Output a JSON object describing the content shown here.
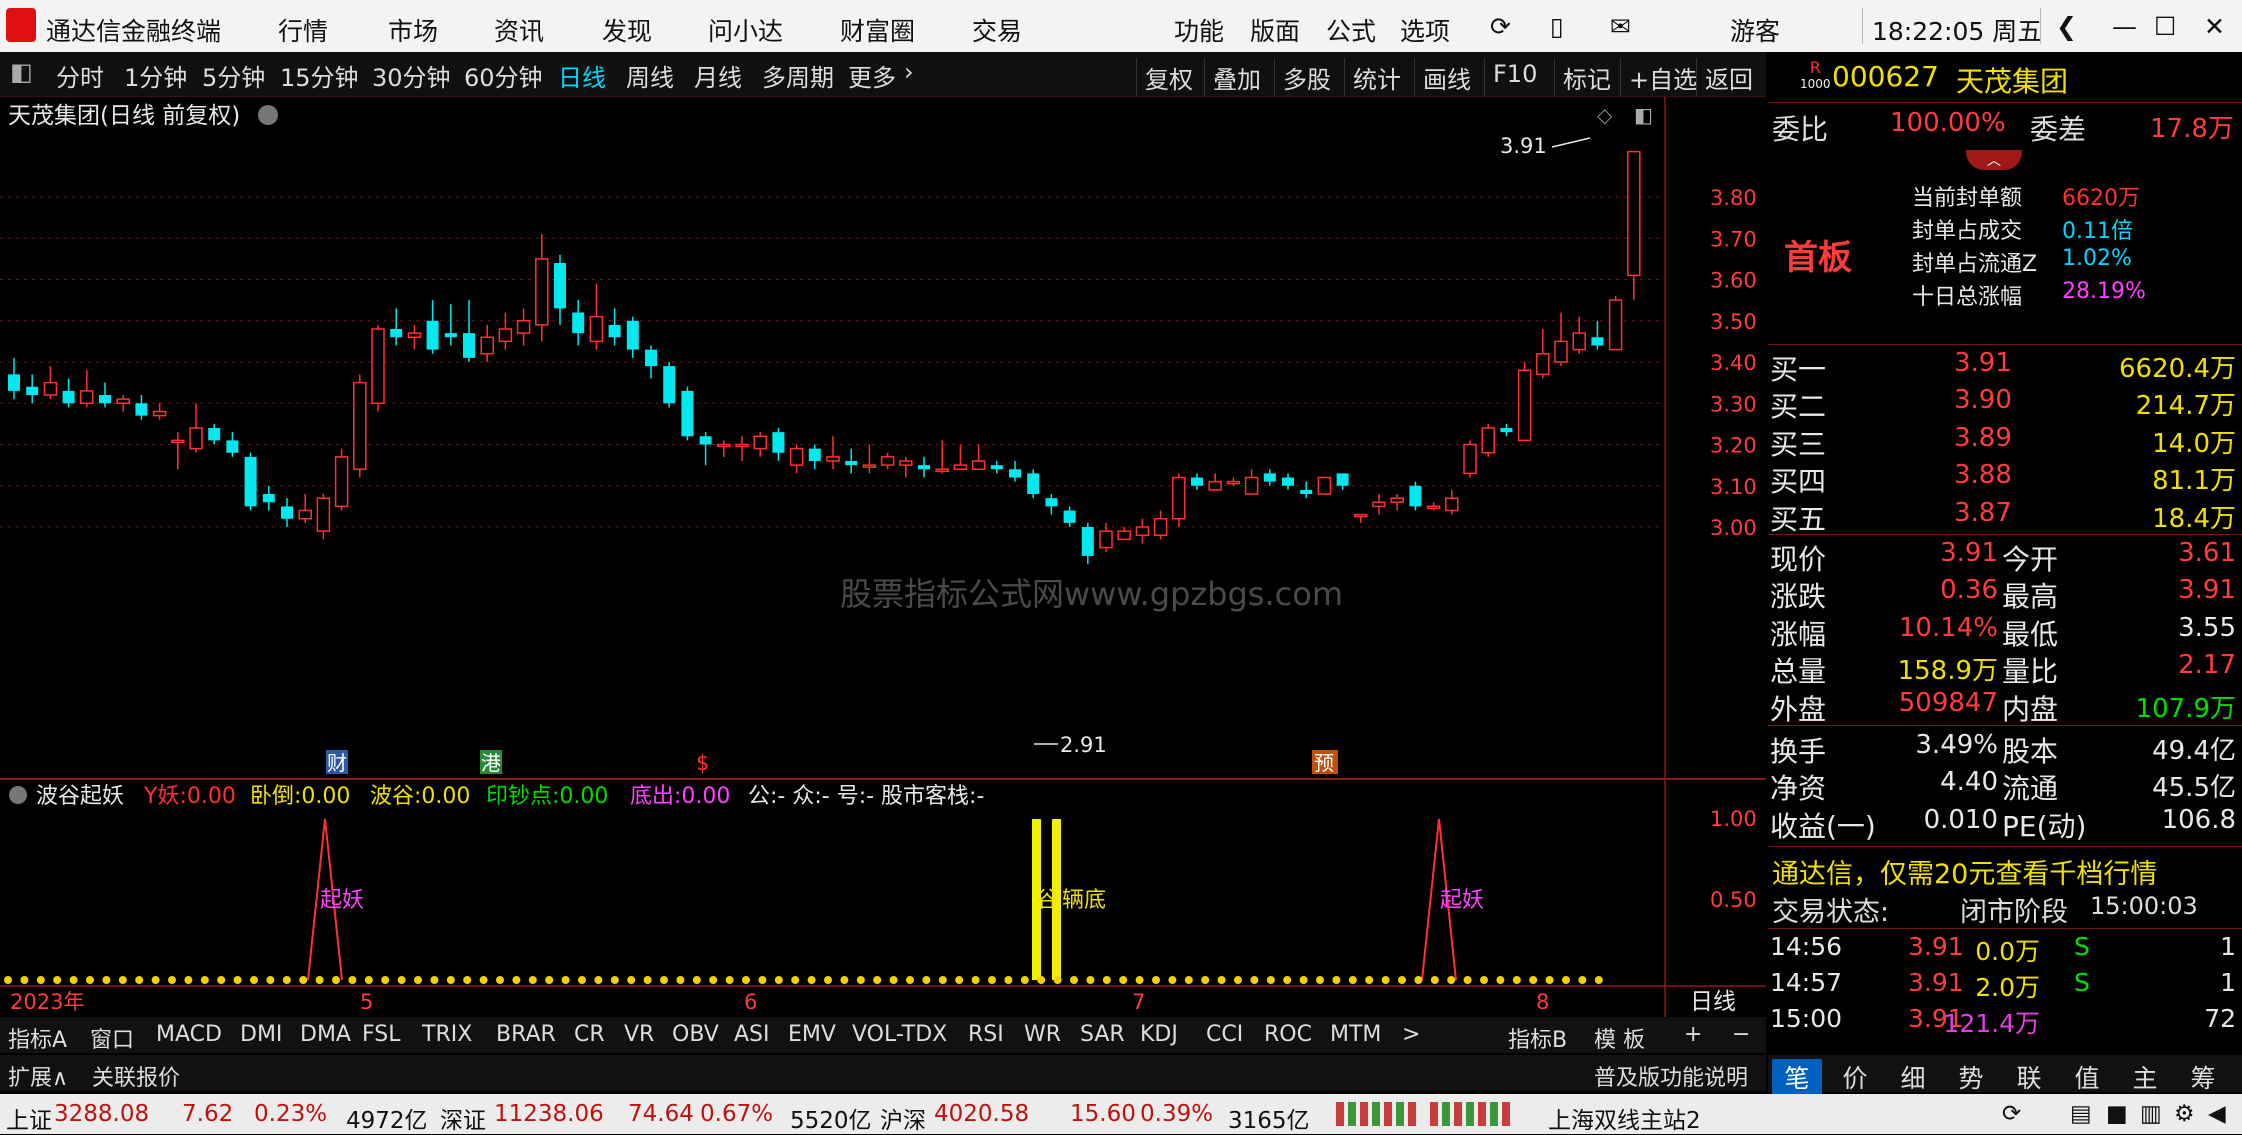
{
  "titlebar": {
    "app_name": "通达信金融终端",
    "menus": [
      "行情",
      "市场",
      "资讯",
      "发现",
      "问小达",
      "财富圈",
      "交易"
    ],
    "tools": [
      "功能",
      "版面",
      "公式",
      "选项"
    ],
    "user": "游客",
    "time": "18:22:05 周五"
  },
  "periodbar": {
    "items": [
      "分时",
      "1分钟",
      "5分钟",
      "15分钟",
      "30分钟",
      "60分钟",
      "日线",
      "周线",
      "月线",
      "多周期",
      "更多"
    ],
    "active": "日线",
    "right_buttons": [
      "复权",
      "叠加",
      "多股",
      "统计",
      "画线",
      "F10",
      "标记",
      "+自选",
      "返回"
    ]
  },
  "chart": {
    "title": "天茂集团(日线 前复权)",
    "price_ticks": [
      "3.80",
      "3.70",
      "3.60",
      "3.50",
      "3.40",
      "3.30",
      "3.20",
      "3.10",
      "3.00"
    ],
    "high_label": "3.91",
    "low_label": "2.91",
    "watermark": "股票指标公式网www.gpzbgs.com",
    "events": [
      {
        "label": "财",
        "color": "#2a5aa8"
      },
      {
        "label": "港",
        "color": "#2a8a3a"
      },
      {
        "label": "$",
        "color": "#ff3030"
      },
      {
        "label": "预",
        "color": "#c05010"
      }
    ],
    "period_label": "日线",
    "x_labels": [
      "2023年",
      "5",
      "6",
      "7",
      "8"
    ]
  },
  "indicator": {
    "name": "波谷起妖",
    "fields": [
      {
        "label": "Y妖:",
        "value": "0.00",
        "color": "#ff3030"
      },
      {
        "label": "卧倒:",
        "value": "0.00",
        "color": "#f0e000"
      },
      {
        "label": "波谷:",
        "value": "0.00",
        "color": "#f0e000"
      },
      {
        "label": "印钞点:",
        "value": "0.00",
        "color": "#00e000"
      },
      {
        "label": "底出:",
        "value": "0.00",
        "color": "#ff40ff"
      }
    ],
    "extra": "公:- 众:- 号:- 股市客栈:-",
    "ticks": [
      "1.00",
      "0.50"
    ],
    "signal_label": "起妖",
    "bar_label": "谷",
    "bar_label2": "辆底"
  },
  "tabs": [
    "指标A",
    "窗口",
    "MACD",
    "DMI",
    "DMA",
    "FSL",
    "TRIX",
    "BRAR",
    "CR",
    "VR",
    "OBV",
    "ASI",
    "EMV",
    "VOL-TDX",
    "RSI",
    "WR",
    "SAR",
    "KDJ",
    "CCI",
    "ROC",
    "MTM"
  ],
  "tabs_right": [
    "指标B",
    "模 板",
    "+",
    "−"
  ],
  "tabs2": [
    "扩展∧",
    "关联报价"
  ],
  "tabs2_right": "普及版功能说明",
  "quote": {
    "badge": "R",
    "badge_sub": "1000",
    "code": "000627",
    "name": "天茂集团",
    "weibi_label": "委比",
    "weibi": "100.00%",
    "weicha_label": "委差",
    "weicha": "17.8万",
    "board": "首板",
    "seal_info": [
      {
        "label": "当前封单额",
        "value": "6620万",
        "color": "#ff3030"
      },
      {
        "label": "封单占成交",
        "value": "0.11倍",
        "color": "#00d8ff"
      },
      {
        "label": "封单占流通Z",
        "value": "1.02%",
        "color": "#00d8ff"
      },
      {
        "label": "十日总涨幅",
        "value": "28.19%",
        "color": "#ff40ff"
      }
    ],
    "bids": [
      {
        "label": "买一",
        "price": "3.91",
        "vol": "6620.4万"
      },
      {
        "label": "买二",
        "price": "3.90",
        "vol": "214.7万"
      },
      {
        "label": "买三",
        "price": "3.89",
        "vol": "14.0万"
      },
      {
        "label": "买四",
        "price": "3.88",
        "vol": "81.1万"
      },
      {
        "label": "买五",
        "price": "3.87",
        "vol": "18.4万"
      }
    ],
    "stats": [
      {
        "k1": "现价",
        "v1": "3.91",
        "c1": "red",
        "k2": "今开",
        "v2": "3.61",
        "c2": "red"
      },
      {
        "k1": "涨跌",
        "v1": "0.36",
        "c1": "red",
        "k2": "最高",
        "v2": "3.91",
        "c2": "red"
      },
      {
        "k1": "涨幅",
        "v1": "10.14%",
        "c1": "red",
        "k2": "最低",
        "v2": "3.55",
        "c2": "wht"
      },
      {
        "k1": "总量",
        "v1": "158.9万",
        "c1": "yel",
        "k2": "量比",
        "v2": "2.17",
        "c2": "red"
      },
      {
        "k1": "外盘",
        "v1": "509847",
        "c1": "red",
        "k2": "内盘",
        "v2": "107.9万",
        "c2": "grn"
      }
    ],
    "stats2": [
      {
        "k1": "换手",
        "v1": "3.49%",
        "k2": "股本",
        "v2": "49.4亿"
      },
      {
        "k1": "净资",
        "v1": "4.40",
        "k2": "流通",
        "v2": "45.5亿"
      },
      {
        "k1": "收益(一)",
        "v1": "0.010",
        "k2": "PE(动)",
        "v2": "106.8"
      }
    ],
    "promo": "通达信，仅需20元查看千档行情",
    "trade_status_label": "交易状态:",
    "trade_status": "闭市阶段",
    "trade_time": "15:00:03",
    "ticks": [
      {
        "time": "14:56",
        "price": "3.91",
        "vol": "0.0万",
        "flag": "S",
        "n": "1"
      },
      {
        "time": "14:57",
        "price": "3.91",
        "vol": "2.0万",
        "flag": "S",
        "n": "1"
      },
      {
        "time": "15:00",
        "price": "3.91",
        "vol": "121.4万",
        "flag": "",
        "n": "72"
      }
    ],
    "bottom_tabs": [
      "笔",
      "价",
      "细",
      "势",
      "联",
      "值",
      "主",
      "筹"
    ]
  },
  "statusbar": {
    "sh_label": "上证",
    "sh": "3288.08",
    "sh_chg": "7.62",
    "sh_pct": "0.23%",
    "sh_amt": "4972亿",
    "sz_label": "深证",
    "sz": "11238.06",
    "sz_chg": "74.64",
    "sz_pct": "0.67%",
    "sz_amt": "5520亿",
    "hs_label": "沪深",
    "hs": "4020.58",
    "hs_chg": "15.60",
    "hs_pct": "0.39%",
    "hs_amt": "3165亿",
    "server": "上海双线主站2"
  },
  "chart_data": {
    "type": "candlestick",
    "title": "天茂集团(日线 前复权)",
    "ylim": [
      2.88,
      3.93
    ],
    "x_labels": [
      "2023年",
      "5",
      "6",
      "7",
      "8"
    ],
    "candles": [
      [
        3.37,
        3.33,
        3.41,
        3.31
      ],
      [
        3.34,
        3.32,
        3.37,
        3.3
      ],
      [
        3.32,
        3.35,
        3.39,
        3.31
      ],
      [
        3.33,
        3.3,
        3.36,
        3.29
      ],
      [
        3.3,
        3.33,
        3.38,
        3.29
      ],
      [
        3.32,
        3.3,
        3.35,
        3.29
      ],
      [
        3.3,
        3.31,
        3.32,
        3.28
      ],
      [
        3.3,
        3.27,
        3.32,
        3.26
      ],
      [
        3.27,
        3.28,
        3.3,
        3.26
      ],
      [
        3.21,
        3.21,
        3.23,
        3.14
      ],
      [
        3.19,
        3.24,
        3.3,
        3.18
      ],
      [
        3.24,
        3.21,
        3.25,
        3.2
      ],
      [
        3.21,
        3.18,
        3.23,
        3.17
      ],
      [
        3.17,
        3.05,
        3.18,
        3.04
      ],
      [
        3.08,
        3.06,
        3.1,
        3.04
      ],
      [
        3.05,
        3.02,
        3.07,
        3.0
      ],
      [
        3.02,
        3.04,
        3.08,
        3.01
      ],
      [
        2.99,
        3.07,
        3.08,
        2.97
      ],
      [
        3.05,
        3.17,
        3.19,
        3.04
      ],
      [
        3.14,
        3.35,
        3.37,
        3.12
      ],
      [
        3.3,
        3.48,
        3.49,
        3.28
      ],
      [
        3.48,
        3.46,
        3.53,
        3.44
      ],
      [
        3.46,
        3.47,
        3.49,
        3.43
      ],
      [
        3.5,
        3.43,
        3.55,
        3.42
      ],
      [
        3.47,
        3.46,
        3.54,
        3.44
      ],
      [
        3.47,
        3.41,
        3.55,
        3.4
      ],
      [
        3.42,
        3.46,
        3.49,
        3.4
      ],
      [
        3.45,
        3.48,
        3.52,
        3.43
      ],
      [
        3.47,
        3.5,
        3.53,
        3.44
      ],
      [
        3.49,
        3.65,
        3.71,
        3.45
      ],
      [
        3.64,
        3.53,
        3.66,
        3.49
      ],
      [
        3.52,
        3.47,
        3.55,
        3.44
      ],
      [
        3.45,
        3.51,
        3.59,
        3.43
      ],
      [
        3.49,
        3.46,
        3.53,
        3.44
      ],
      [
        3.5,
        3.43,
        3.51,
        3.41
      ],
      [
        3.43,
        3.39,
        3.44,
        3.36
      ],
      [
        3.39,
        3.3,
        3.4,
        3.29
      ],
      [
        3.33,
        3.22,
        3.34,
        3.21
      ],
      [
        3.22,
        3.2,
        3.23,
        3.15
      ],
      [
        3.2,
        3.2,
        3.21,
        3.17
      ],
      [
        3.2,
        3.2,
        3.22,
        3.16
      ],
      [
        3.19,
        3.22,
        3.23,
        3.17
      ],
      [
        3.23,
        3.18,
        3.24,
        3.16
      ],
      [
        3.15,
        3.19,
        3.2,
        3.13
      ],
      [
        3.19,
        3.16,
        3.2,
        3.14
      ],
      [
        3.16,
        3.17,
        3.22,
        3.14
      ],
      [
        3.16,
        3.15,
        3.19,
        3.13
      ],
      [
        3.15,
        3.15,
        3.2,
        3.13
      ],
      [
        3.15,
        3.17,
        3.18,
        3.14
      ],
      [
        3.15,
        3.16,
        3.17,
        3.12
      ],
      [
        3.15,
        3.14,
        3.17,
        3.12
      ],
      [
        3.14,
        3.14,
        3.21,
        3.13
      ],
      [
        3.14,
        3.15,
        3.2,
        3.14
      ],
      [
        3.14,
        3.16,
        3.2,
        3.14
      ],
      [
        3.15,
        3.14,
        3.16,
        3.13
      ],
      [
        3.14,
        3.12,
        3.16,
        3.11
      ],
      [
        3.13,
        3.08,
        3.14,
        3.07
      ],
      [
        3.07,
        3.05,
        3.08,
        3.03
      ],
      [
        3.04,
        3.01,
        3.05,
        3.0
      ],
      [
        3.0,
        2.93,
        3.01,
        2.91
      ],
      [
        2.95,
        2.99,
        3.01,
        2.94
      ],
      [
        2.97,
        2.99,
        3.0,
        2.97
      ],
      [
        2.98,
        3.0,
        3.02,
        2.96
      ],
      [
        2.98,
        3.02,
        3.04,
        2.97
      ],
      [
        3.02,
        3.12,
        3.13,
        3.0
      ],
      [
        3.12,
        3.1,
        3.13,
        3.09
      ],
      [
        3.09,
        3.11,
        3.13,
        3.09
      ],
      [
        3.11,
        3.11,
        3.12,
        3.1
      ],
      [
        3.08,
        3.12,
        3.14,
        3.08
      ],
      [
        3.13,
        3.11,
        3.14,
        3.1
      ],
      [
        3.12,
        3.1,
        3.13,
        3.09
      ],
      [
        3.09,
        3.08,
        3.11,
        3.07
      ],
      [
        3.08,
        3.12,
        3.12,
        3.08
      ],
      [
        3.13,
        3.1,
        3.13,
        3.09
      ],
      [
        3.03,
        3.03,
        3.03,
        3.01
      ],
      [
        3.05,
        3.06,
        3.08,
        3.03
      ],
      [
        3.06,
        3.07,
        3.08,
        3.04
      ],
      [
        3.1,
        3.05,
        3.11,
        3.04
      ],
      [
        3.05,
        3.05,
        3.06,
        3.04
      ],
      [
        3.04,
        3.07,
        3.09,
        3.03
      ],
      [
        3.13,
        3.2,
        3.21,
        3.12
      ],
      [
        3.18,
        3.24,
        3.25,
        3.17
      ],
      [
        3.24,
        3.23,
        3.25,
        3.22
      ],
      [
        3.21,
        3.38,
        3.4,
        3.21
      ],
      [
        3.37,
        3.42,
        3.48,
        3.36
      ],
      [
        3.4,
        3.45,
        3.52,
        3.39
      ],
      [
        3.43,
        3.47,
        3.51,
        3.42
      ],
      [
        3.46,
        3.44,
        3.5,
        3.43
      ],
      [
        3.43,
        3.55,
        3.56,
        3.43
      ],
      [
        3.61,
        3.91,
        3.91,
        3.55
      ]
    ],
    "indicator_signals": [
      {
        "name": "起妖",
        "position": "mid"
      },
      {
        "name": "谷",
        "position": "bars"
      },
      {
        "name": "起妖",
        "position": "end"
      }
    ]
  }
}
